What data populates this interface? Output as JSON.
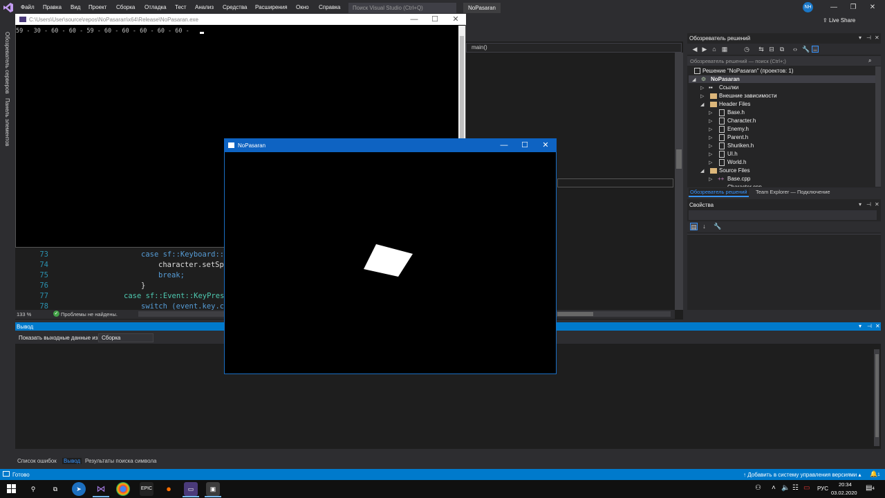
{
  "menu": {
    "items": [
      "Файл",
      "Правка",
      "Вид",
      "Проект",
      "Сборка",
      "Отладка",
      "Тест",
      "Анализ",
      "Средства",
      "Расширения",
      "Окно",
      "Справка"
    ],
    "search_placeholder": "Поиск Visual Studio (Ctrl+Q)",
    "solution_name": "NoPasaran",
    "avatar_initials": "NH",
    "live_share": "Live Share"
  },
  "left_tabs": [
    "Обозреватель серверов",
    "Панель элементов"
  ],
  "editor": {
    "nav_member": "main()",
    "lines": [
      {
        "num": "73",
        "code": "case sf::Keyboard::"
      },
      {
        "num": "74",
        "code": "character.setSp"
      },
      {
        "num": "75",
        "code": "break;"
      },
      {
        "num": "76",
        "code": "}"
      },
      {
        "num": "77",
        "code": "case sf::Event::KeyPres"
      },
      {
        "num": "78",
        "code": "switch (event.key.c"
      }
    ],
    "zoom": "133 %",
    "problems": "Проблемы не найдены."
  },
  "solution_explorer": {
    "title": "Обозреватель решений",
    "search_placeholder": "Обозреватель решений — поиск (Ctrl+;)",
    "solution_node": "Решение \"NoPasaran\" (проектов: 1)",
    "project": "NoPasaran",
    "references": "Ссылки",
    "external": "Внешние зависимости",
    "header_folder": "Header Files",
    "headers": [
      "Base.h",
      "Character.h",
      "Enemy.h",
      "Parent.h",
      "Shuriken.h",
      "UI.h",
      "World.h"
    ],
    "source_folder": "Source Files",
    "sources": [
      "Base.cpp",
      "Character.cpp"
    ],
    "tabs": [
      "Обозреватель решений",
      "Team Explorer — Подключение"
    ]
  },
  "properties": {
    "title": "Свойства"
  },
  "output": {
    "title": "Вывод",
    "show_label": "Показать выходные данные из:",
    "source": "Сборка"
  },
  "bottom_tabs": [
    "Список ошибок",
    "Вывод",
    "Результаты поиска символа"
  ],
  "statusbar": {
    "ready": "Готово",
    "source_control": "Добавить в систему управления версиями",
    "notifications": "1"
  },
  "taskbar": {
    "lang": "РУС",
    "time": "20:34",
    "date": "03.02.2020",
    "notif_count": "4"
  },
  "console": {
    "title": "C:\\Users\\User\\source\\repos\\NoPasaran\\x64\\Release\\NoPasaran.exe",
    "output": "59 - 30 - 60 - 60 - 59 - 60 - 60 - 60 - 60 - 60 - "
  },
  "game_window": {
    "title": "NoPasaran"
  },
  "colors": {
    "accent": "#007acc",
    "editor_bg": "#1e1e1e",
    "chrome_bg": "#2d2d30",
    "game_titlebar": "#0e63c2"
  }
}
